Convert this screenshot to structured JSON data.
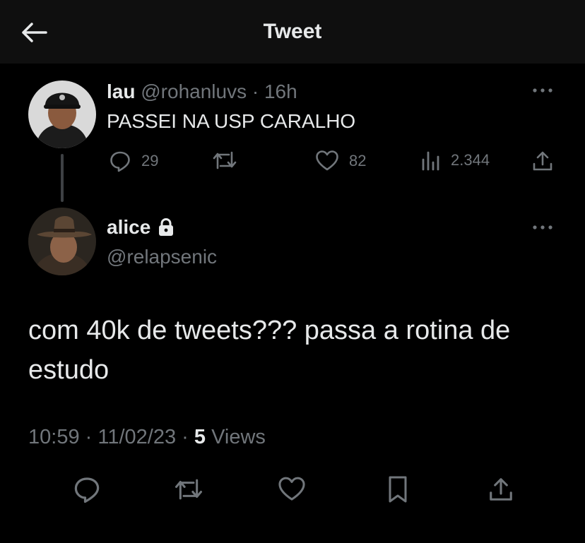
{
  "header": {
    "title": "Tweet",
    "back_icon": "arrow-left-icon"
  },
  "original_tweet": {
    "name": "lau",
    "handle": "@rohanluvs",
    "separator": "·",
    "time": "16h",
    "text": "PASSEI NA USP CARALHO",
    "stats": {
      "replies": "29",
      "likes": "82",
      "views": "2.344"
    }
  },
  "reply_tweet": {
    "name": "alice",
    "protected_icon": "lock-icon",
    "handle": "@relapsenic",
    "text": "com 40k de tweets??? passa a rotina de estudo",
    "time": "10:59",
    "date": "11/02/23",
    "views_count": "5",
    "views_label": "Views"
  },
  "colors": {
    "background": "#000000",
    "text": "#e7e9ea",
    "muted": "#71767b",
    "header_bg": "#0f0f0f"
  }
}
